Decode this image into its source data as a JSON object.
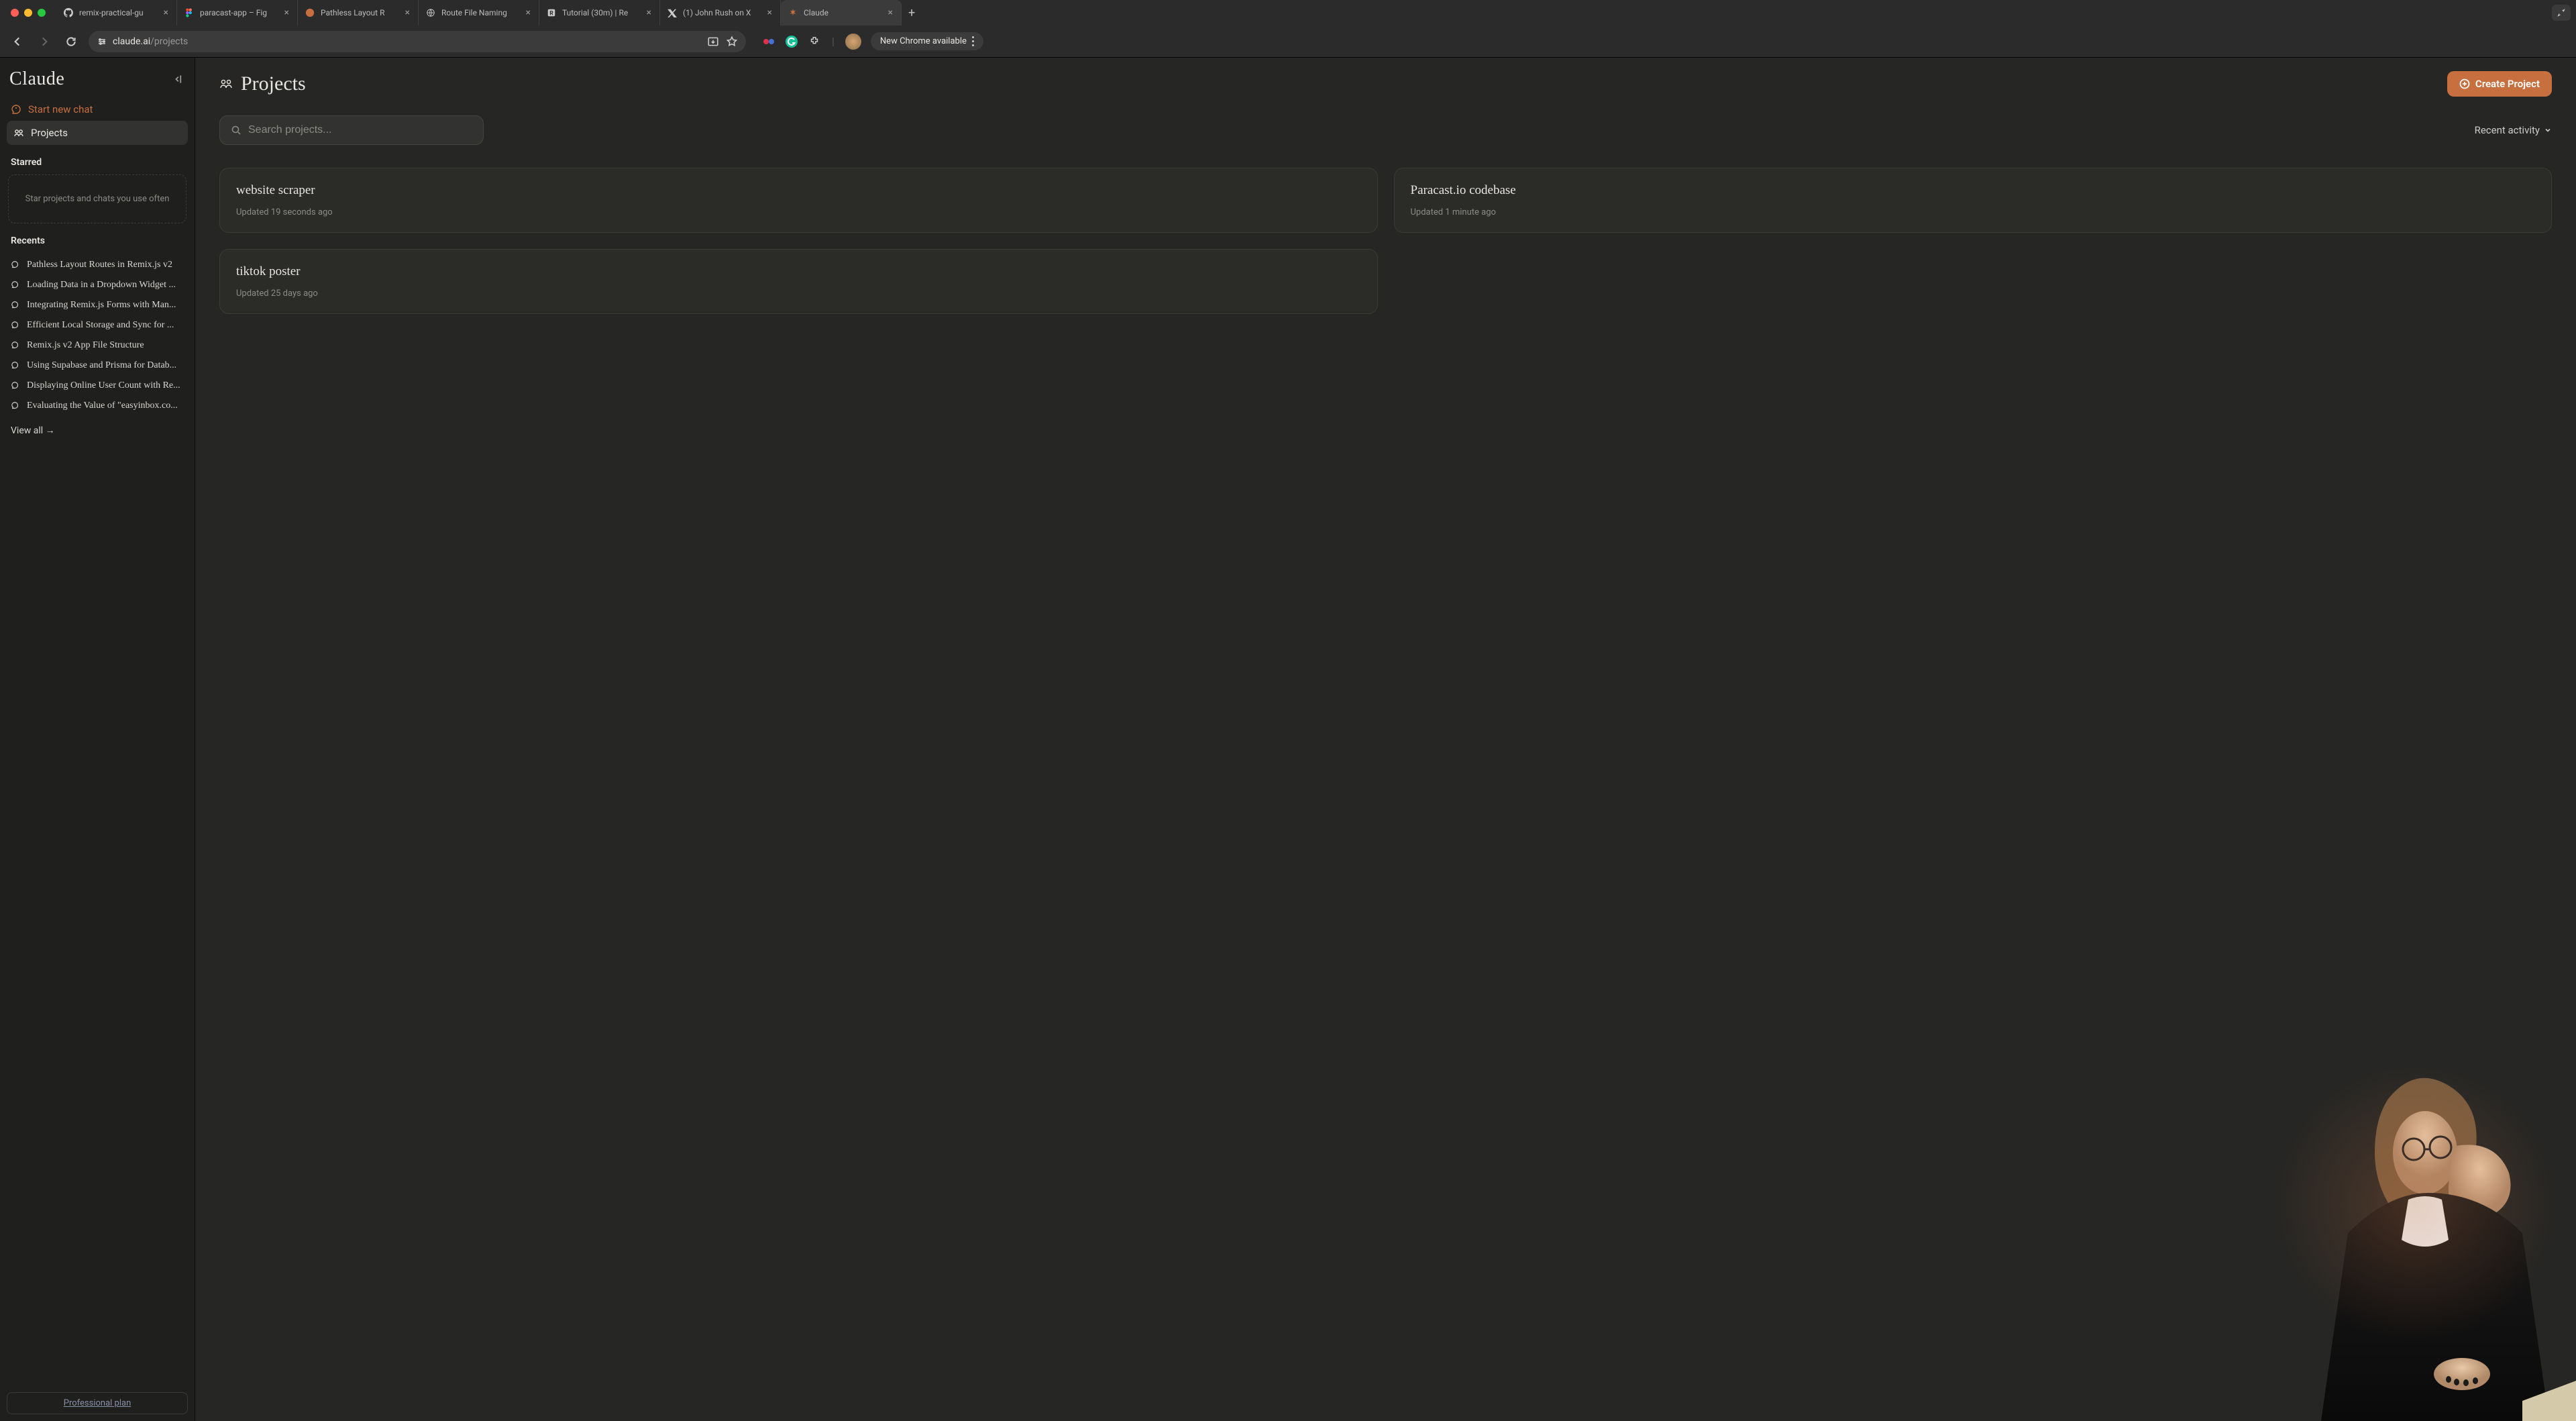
{
  "browser": {
    "tabs": [
      {
        "title": "remix-practical-gu",
        "icon": "github"
      },
      {
        "title": "paracast-app – Fig",
        "icon": "figma"
      },
      {
        "title": "Pathless Layout R",
        "icon": "claude"
      },
      {
        "title": "Route File Naming",
        "icon": "globe"
      },
      {
        "title": "Tutorial (30m) | Re",
        "icon": "remix"
      },
      {
        "title": "(1) John Rush on X",
        "icon": "x"
      },
      {
        "title": "Claude",
        "icon": "claude",
        "active": true
      }
    ],
    "url_domain": "claude.ai",
    "url_path": "/projects",
    "chrome_button": "New Chrome available"
  },
  "sidebar": {
    "brand": "Claude",
    "new_chat": "Start new chat",
    "projects_label": "Projects",
    "starred_label": "Starred",
    "starred_empty": "Star projects and chats you use often",
    "recents_label": "Recents",
    "recents": [
      "Pathless Layout Routes in Remix.js v2",
      "Loading Data in a Dropdown Widget ...",
      "Integrating Remix.js Forms with Man...",
      "Efficient Local Storage and Sync for ...",
      "Remix.js v2 App File Structure",
      "Using Supabase and Prisma for Datab...",
      "Displaying Online User Count with Re...",
      "Evaluating the Value of \"easyinbox.co..."
    ],
    "view_all": "View all →",
    "plan": "Professional plan"
  },
  "main": {
    "title": "Projects",
    "create_button": "Create Project",
    "search_placeholder": "Search projects...",
    "sort_label": "Recent activity",
    "projects": [
      {
        "title": "website scraper",
        "meta": "Updated 19 seconds ago"
      },
      {
        "title": "Paracast.io codebase",
        "meta": "Updated 1 minute ago"
      },
      {
        "title": "tiktok poster",
        "meta": "Updated 25 days ago"
      }
    ]
  }
}
